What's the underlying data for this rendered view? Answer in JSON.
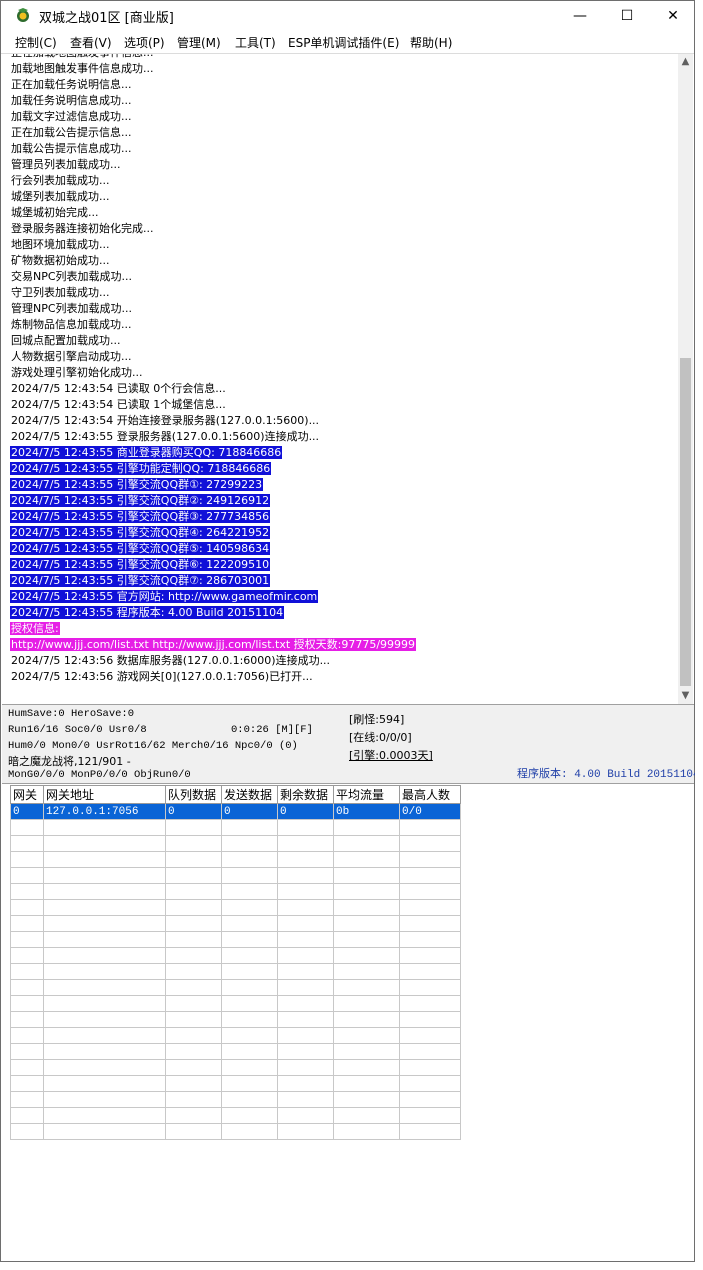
{
  "window": {
    "title": "双城之战01区 [商业版]",
    "controls": {
      "minimize": "—",
      "maximize": "☐",
      "close": "✕"
    }
  },
  "menu": [
    {
      "label": "控制(C)"
    },
    {
      "label": "查看(V)"
    },
    {
      "label": "选项(P)"
    },
    {
      "label": "管理(M)"
    },
    {
      "label": "工具(T)"
    },
    {
      "label": "ESP单机调试插件(E)"
    },
    {
      "label": "帮助(H)"
    }
  ],
  "log": [
    {
      "text": "正在加载地图触发事件信息...",
      "style": ""
    },
    {
      "text": "加载地图触发事件信息成功...",
      "style": ""
    },
    {
      "text": "正在加载任务说明信息...",
      "style": ""
    },
    {
      "text": "加载任务说明信息成功...",
      "style": ""
    },
    {
      "text": "加载文字过滤信息成功...",
      "style": ""
    },
    {
      "text": "正在加载公告提示信息...",
      "style": ""
    },
    {
      "text": "加载公告提示信息成功...",
      "style": ""
    },
    {
      "text": "管理员列表加载成功...",
      "style": ""
    },
    {
      "text": "行会列表加载成功...",
      "style": ""
    },
    {
      "text": "城堡列表加载成功...",
      "style": ""
    },
    {
      "text": "城堡城初始完成...",
      "style": ""
    },
    {
      "text": "登录服务器连接初始化完成...",
      "style": ""
    },
    {
      "text": "地图环境加载成功...",
      "style": ""
    },
    {
      "text": "矿物数据初始成功...",
      "style": ""
    },
    {
      "text": "交易NPC列表加载成功...",
      "style": ""
    },
    {
      "text": "守卫列表加载成功...",
      "style": ""
    },
    {
      "text": "管理NPC列表加载成功...",
      "style": ""
    },
    {
      "text": "炼制物品信息加载成功...",
      "style": ""
    },
    {
      "text": "回城点配置加载成功...",
      "style": ""
    },
    {
      "text": "人物数据引擎启动成功...",
      "style": ""
    },
    {
      "text": "游戏处理引擎初始化成功...",
      "style": ""
    },
    {
      "text": "2024/7/5 12:43:54 已读取 0个行会信息...",
      "style": ""
    },
    {
      "text": "2024/7/5 12:43:54 已读取 1个城堡信息...",
      "style": ""
    },
    {
      "text": "2024/7/5 12:43:54 开始连接登录服务器(127.0.0.1:5600)...",
      "style": ""
    },
    {
      "text": "2024/7/5 12:43:55 登录服务器(127.0.0.1:5600)连接成功...",
      "style": ""
    },
    {
      "text": "2024/7/5 12:43:55 商业登录器购买QQ: 718846686",
      "style": "hl-blue"
    },
    {
      "text": "2024/7/5 12:43:55 引擎功能定制QQ: 718846686",
      "style": "hl-blue"
    },
    {
      "text": "2024/7/5 12:43:55 引擎交流QQ群①: 27299223",
      "style": "hl-blue"
    },
    {
      "text": "2024/7/5 12:43:55 引擎交流QQ群②: 249126912",
      "style": "hl-blue"
    },
    {
      "text": "2024/7/5 12:43:55 引擎交流QQ群③: 277734856",
      "style": "hl-blue"
    },
    {
      "text": "2024/7/5 12:43:55 引擎交流QQ群④: 264221952",
      "style": "hl-blue"
    },
    {
      "text": "2024/7/5 12:43:55 引擎交流QQ群⑤: 140598634",
      "style": "hl-blue"
    },
    {
      "text": "2024/7/5 12:43:55 引擎交流QQ群⑥: 122209510",
      "style": "hl-blue"
    },
    {
      "text": "2024/7/5 12:43:55 引擎交流QQ群⑦: 286703001",
      "style": "hl-blue"
    },
    {
      "text": "2024/7/5 12:43:55 官方网站: http://www.gameofmir.com",
      "style": "hl-blue"
    },
    {
      "text": "2024/7/5 12:43:55 程序版本: 4.00 Build 20151104",
      "style": "hl-blue"
    },
    {
      "text": "授权信息:",
      "style": "hl-pink"
    },
    {
      "text": "http://www.jjj.com/list.txt http://www.jjj.com/list.txt 授权天数:97775/99999",
      "style": "hl-pink"
    },
    {
      "text": "2024/7/5 12:43:56 数据库服务器(127.0.0.1:6000)连接成功...",
      "style": ""
    },
    {
      "text": "2024/7/5 12:43:56 游戏网关[0](127.0.0.1:7056)已打开...",
      "style": ""
    }
  ],
  "status": {
    "humsave": "HumSave:0 HeroSave:0",
    "run": "Run16/16 Soc0/0 Usr0/8",
    "timer": "0:0:26 [M][F]",
    "hum": "Hum0/0 Mon0/0 UsrRot16/62 Merch0/16 Npc0/0 (0)",
    "boss": "暗之魔龙战将,121/901 -",
    "mon": "MonG0/0/0 MonP0/0/0 ObjRun0/0",
    "refresh": "[刷怪:594]",
    "online": "[在线:0/0/0]",
    "engine": "[引擎:0.0003天]",
    "version": "程序版本: 4.00 Build 20151104"
  },
  "gateway_table": {
    "headers": [
      "网关",
      "网关地址",
      "队列数据",
      "发送数据",
      "剩余数据",
      "平均流量",
      "最高人数"
    ],
    "rows": [
      [
        "0",
        "127.0.0.1:7056",
        "0",
        "0",
        "0",
        "0b",
        "0/0"
      ]
    ]
  }
}
